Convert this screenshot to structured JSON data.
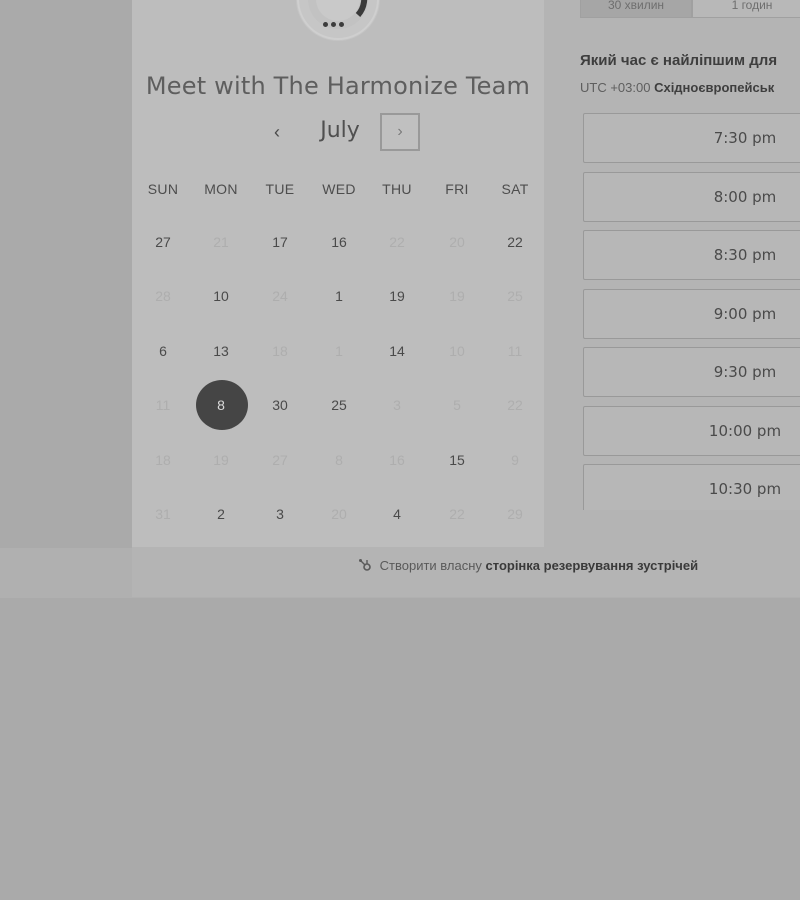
{
  "meeting": {
    "title": "Meet with The Harmonize Team"
  },
  "calendar": {
    "month": "July",
    "prev_icon": "‹",
    "next_icon": "›",
    "weekdays": [
      "SUN",
      "MON",
      "TUE",
      "WED",
      "THU",
      "FRI",
      "SAT"
    ],
    "weeks": [
      [
        {
          "d": "27",
          "muted": false
        },
        {
          "d": "21",
          "muted": true
        },
        {
          "d": "17",
          "muted": false
        },
        {
          "d": "16",
          "muted": false
        },
        {
          "d": "22",
          "muted": true
        },
        {
          "d": "20",
          "muted": true
        },
        {
          "d": "22",
          "muted": false
        }
      ],
      [
        {
          "d": "28",
          "muted": true
        },
        {
          "d": "10",
          "muted": false
        },
        {
          "d": "24",
          "muted": true
        },
        {
          "d": "1",
          "muted": false
        },
        {
          "d": "19",
          "muted": false
        },
        {
          "d": "19",
          "muted": true
        },
        {
          "d": "25",
          "muted": true
        }
      ],
      [
        {
          "d": "6",
          "muted": false
        },
        {
          "d": "13",
          "muted": false
        },
        {
          "d": "18",
          "muted": true
        },
        {
          "d": "1",
          "muted": true
        },
        {
          "d": "14",
          "muted": false
        },
        {
          "d": "10",
          "muted": true
        },
        {
          "d": "11",
          "muted": true
        }
      ],
      [
        {
          "d": "11",
          "muted": true
        },
        {
          "d": "8",
          "muted": false,
          "selected": true
        },
        {
          "d": "30",
          "muted": false
        },
        {
          "d": "25",
          "muted": false
        },
        {
          "d": "3",
          "muted": true
        },
        {
          "d": "5",
          "muted": true
        },
        {
          "d": "22",
          "muted": true
        }
      ],
      [
        {
          "d": "18",
          "muted": true
        },
        {
          "d": "19",
          "muted": true
        },
        {
          "d": "27",
          "muted": true
        },
        {
          "d": "8",
          "muted": true
        },
        {
          "d": "16",
          "muted": true
        },
        {
          "d": "15",
          "muted": false
        },
        {
          "d": "9",
          "muted": true
        }
      ],
      [
        {
          "d": "31",
          "muted": true
        },
        {
          "d": "2",
          "muted": false
        },
        {
          "d": "3",
          "muted": false
        },
        {
          "d": "20",
          "muted": true
        },
        {
          "d": "4",
          "muted": false
        },
        {
          "d": "22",
          "muted": true
        },
        {
          "d": "29",
          "muted": true
        }
      ]
    ]
  },
  "duration": {
    "options": [
      "30 хвилин",
      "1 годин"
    ],
    "selected": "30 хвилин"
  },
  "times": {
    "heading": "Який час є найліпшим для",
    "tz_offset": "UTC +03:00",
    "tz_name": "Східноєвропейськ",
    "slots": [
      "7:30 pm",
      "8:00 pm",
      "8:30 pm",
      "9:00 pm",
      "9:30 pm",
      "10:00 pm",
      "10:30 pm"
    ]
  },
  "footer": {
    "prefix": "Створити власну",
    "link": "сторінка резервування зустрічей"
  },
  "colors": {
    "selected_day": "#454545",
    "page_background": "#aaaaaa"
  }
}
